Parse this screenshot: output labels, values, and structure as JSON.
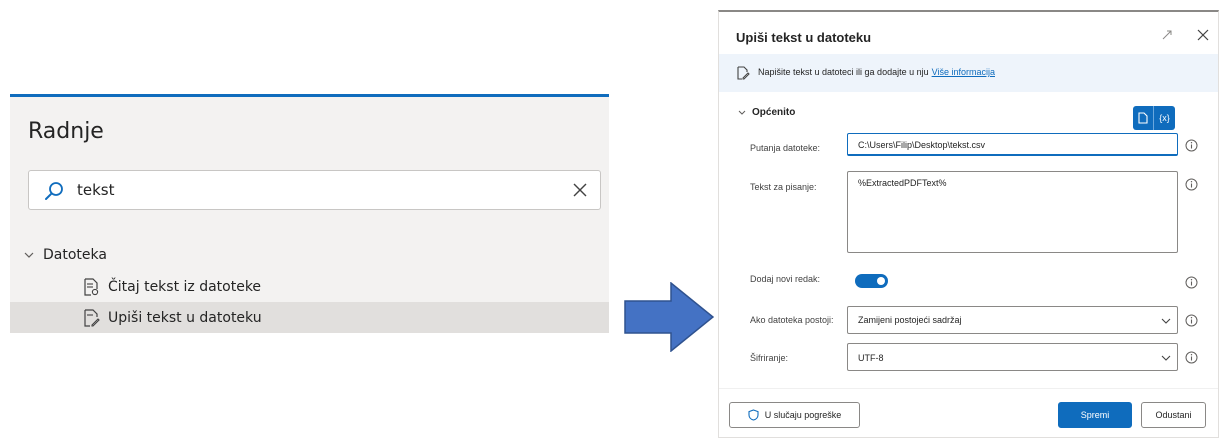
{
  "actions_panel": {
    "title": "Radnje",
    "search": {
      "value": "tekst",
      "search_icon": "search-icon",
      "clear_icon": "close-icon"
    },
    "group": {
      "label": "Datoteka",
      "icon": "chevron-down-icon"
    },
    "items": [
      {
        "label": "Čitaj tekst iz datoteke",
        "icon": "read-file-icon",
        "selected": false
      },
      {
        "label": "Upiši tekst u datoteku",
        "icon": "write-file-icon",
        "selected": true
      }
    ]
  },
  "arrow": {
    "color": "#4472c4",
    "icon": "right-arrow-icon"
  },
  "dialog": {
    "title": "Upiši tekst u datoteku",
    "info_text": "Napišite tekst u datoteci ili ga dodajte u nju",
    "info_link": "Više informacija",
    "section": "Općenito",
    "var_button_label": "{x}",
    "fields": {
      "path": {
        "label": "Putanja datoteke:",
        "value": "C:\\Users\\Filip\\Desktop\\tekst.csv"
      },
      "text": {
        "label": "Tekst za pisanje:",
        "value": "%ExtractedPDFText%"
      },
      "newline": {
        "label": "Dodaj novi redak:",
        "on": true
      },
      "exists": {
        "label": "Ako datoteka postoji:",
        "value": "Zamijeni postojeći sadržaj"
      },
      "encoding": {
        "label": "Šifriranje:",
        "value": "UTF-8"
      }
    },
    "buttons": {
      "on_error": "U slučaju pogreške",
      "save": "Spremi",
      "cancel": "Odustani"
    },
    "accent": "#0f6cbd"
  }
}
